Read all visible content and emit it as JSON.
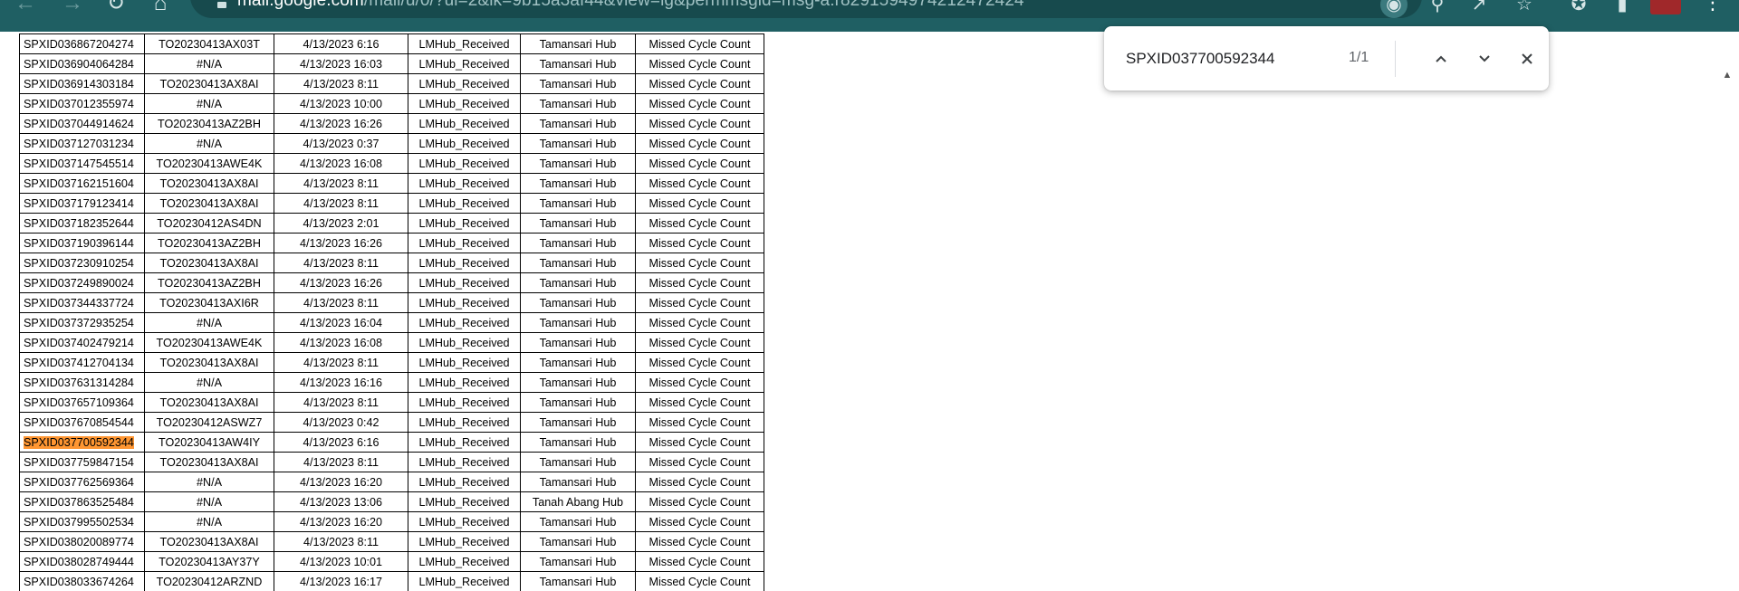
{
  "browser": {
    "url_host": "mail.google.com",
    "url_path": "/mail/u/0/?ui=2&ik=9b15a3af44&view=lg&permmsgid=msg-a:r8291594974212472424",
    "icons": [
      "back-icon",
      "forward-icon",
      "reload-icon",
      "home-icon",
      "lock-icon",
      "lens-icon",
      "zoom-icon",
      "share-icon",
      "bookmark-star-icon",
      "extensions-icon",
      "sidepanel-icon",
      "profile-avatar",
      "menu-icon"
    ]
  },
  "find_bar": {
    "query": "SPXID037700592344",
    "count": "1/1",
    "icons": [
      "previous-match-icon",
      "next-match-icon",
      "close-icon"
    ]
  },
  "table": {
    "highlighted_row_index": 20,
    "rows": [
      [
        "SPXID036867204274",
        "TO20230413AX03T",
        "4/13/2023 6:16",
        "LMHub_Received",
        "Tamansari Hub",
        "Missed Cycle Count"
      ],
      [
        "SPXID036904064284",
        "#N/A",
        "4/13/2023 16:03",
        "LMHub_Received",
        "Tamansari Hub",
        "Missed Cycle Count"
      ],
      [
        "SPXID036914303184",
        "TO20230413AX8AI",
        "4/13/2023 8:11",
        "LMHub_Received",
        "Tamansari Hub",
        "Missed Cycle Count"
      ],
      [
        "SPXID037012355974",
        "#N/A",
        "4/13/2023 10:00",
        "LMHub_Received",
        "Tamansari Hub",
        "Missed Cycle Count"
      ],
      [
        "SPXID037044914624",
        "TO20230413AZ2BH",
        "4/13/2023 16:26",
        "LMHub_Received",
        "Tamansari Hub",
        "Missed Cycle Count"
      ],
      [
        "SPXID037127031234",
        "#N/A",
        "4/13/2023 0:37",
        "LMHub_Received",
        "Tamansari Hub",
        "Missed Cycle Count"
      ],
      [
        "SPXID037147545514",
        "TO20230413AWE4K",
        "4/13/2023 16:08",
        "LMHub_Received",
        "Tamansari Hub",
        "Missed Cycle Count"
      ],
      [
        "SPXID037162151604",
        "TO20230413AX8AI",
        "4/13/2023 8:11",
        "LMHub_Received",
        "Tamansari Hub",
        "Missed Cycle Count"
      ],
      [
        "SPXID037179123414",
        "TO20230413AX8AI",
        "4/13/2023 8:11",
        "LMHub_Received",
        "Tamansari Hub",
        "Missed Cycle Count"
      ],
      [
        "SPXID037182352644",
        "TO20230412AS4DN",
        "4/13/2023 2:01",
        "LMHub_Received",
        "Tamansari Hub",
        "Missed Cycle Count"
      ],
      [
        "SPXID037190396144",
        "TO20230413AZ2BH",
        "4/13/2023 16:26",
        "LMHub_Received",
        "Tamansari Hub",
        "Missed Cycle Count"
      ],
      [
        "SPXID037230910254",
        "TO20230413AX8AI",
        "4/13/2023 8:11",
        "LMHub_Received",
        "Tamansari Hub",
        "Missed Cycle Count"
      ],
      [
        "SPXID037249890024",
        "TO20230413AZ2BH",
        "4/13/2023 16:26",
        "LMHub_Received",
        "Tamansari Hub",
        "Missed Cycle Count"
      ],
      [
        "SPXID037344337724",
        "TO20230413AXI6R",
        "4/13/2023 8:11",
        "LMHub_Received",
        "Tamansari Hub",
        "Missed Cycle Count"
      ],
      [
        "SPXID037372935254",
        "#N/A",
        "4/13/2023 16:04",
        "LMHub_Received",
        "Tamansari Hub",
        "Missed Cycle Count"
      ],
      [
        "SPXID037402479214",
        "TO20230413AWE4K",
        "4/13/2023 16:08",
        "LMHub_Received",
        "Tamansari Hub",
        "Missed Cycle Count"
      ],
      [
        "SPXID037412704134",
        "TO20230413AX8AI",
        "4/13/2023 8:11",
        "LMHub_Received",
        "Tamansari Hub",
        "Missed Cycle Count"
      ],
      [
        "SPXID037631314284",
        "#N/A",
        "4/13/2023 16:16",
        "LMHub_Received",
        "Tamansari Hub",
        "Missed Cycle Count"
      ],
      [
        "SPXID037657109364",
        "TO20230413AX8AI",
        "4/13/2023 8:11",
        "LMHub_Received",
        "Tamansari Hub",
        "Missed Cycle Count"
      ],
      [
        "SPXID037670854544",
        "TO20230412ASWZ7",
        "4/13/2023 0:42",
        "LMHub_Received",
        "Tamansari Hub",
        "Missed Cycle Count"
      ],
      [
        "SPXID037700592344",
        "TO20230413AW4IY",
        "4/13/2023 6:16",
        "LMHub_Received",
        "Tamansari Hub",
        "Missed Cycle Count"
      ],
      [
        "SPXID037759847154",
        "TO20230413AX8AI",
        "4/13/2023 8:11",
        "LMHub_Received",
        "Tamansari Hub",
        "Missed Cycle Count"
      ],
      [
        "SPXID037762569364",
        "#N/A",
        "4/13/2023 16:20",
        "LMHub_Received",
        "Tamansari Hub",
        "Missed Cycle Count"
      ],
      [
        "SPXID037863525484",
        "#N/A",
        "4/13/2023 13:06",
        "LMHub_Received",
        "Tanah Abang Hub",
        "Missed Cycle Count"
      ],
      [
        "SPXID037995502534",
        "#N/A",
        "4/13/2023 16:20",
        "LMHub_Received",
        "Tamansari Hub",
        "Missed Cycle Count"
      ],
      [
        "SPXID038020089774",
        "TO20230413AX8AI",
        "4/13/2023 8:11",
        "LMHub_Received",
        "Tamansari Hub",
        "Missed Cycle Count"
      ],
      [
        "SPXID038028749444",
        "TO20230413AY37Y",
        "4/13/2023 10:01",
        "LMHub_Received",
        "Tamansari Hub",
        "Missed Cycle Count"
      ],
      [
        "SPXID038033674264",
        "TO20230412ARZND",
        "4/13/2023 16:17",
        "LMHub_Received",
        "Tamansari Hub",
        "Missed Cycle Count"
      ]
    ]
  },
  "colors": {
    "toolbar": "#1f5f63",
    "find_highlight": "#ff9632"
  }
}
